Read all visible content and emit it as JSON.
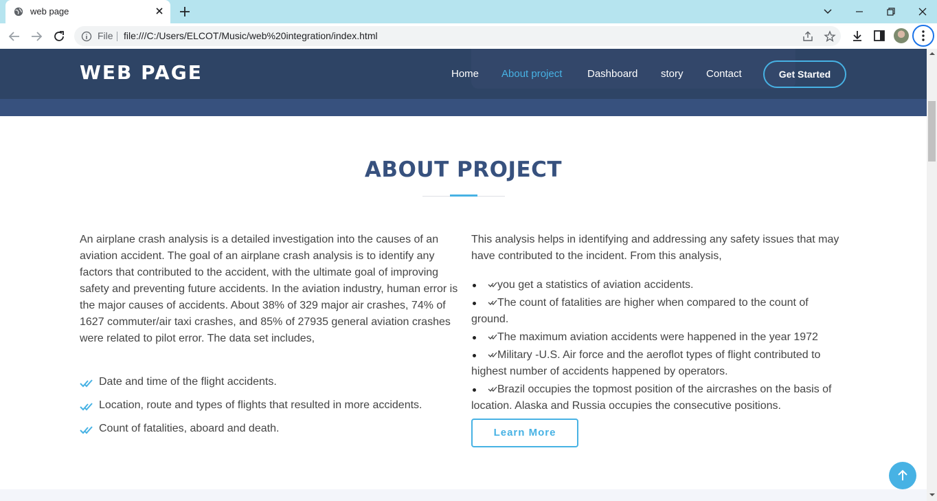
{
  "browser": {
    "tab_title": "web page",
    "omnibox": {
      "scheme_label": "File",
      "url": "file:///C:/Users/ELCOT/Music/web%20integration/index.html"
    },
    "icons": [
      "globe-icon",
      "close-icon",
      "plus-icon",
      "chevron-down-icon",
      "minimize-icon",
      "restore-icon",
      "window-close-icon",
      "back-arrow-icon",
      "forward-arrow-icon",
      "reload-icon",
      "info-icon",
      "share-icon",
      "star-icon",
      "download-icon",
      "sidebar-icon",
      "profile-avatar",
      "more-vert-icon"
    ]
  },
  "site": {
    "logo": "WEB PAGE",
    "nav": [
      {
        "label": "Home",
        "active": false
      },
      {
        "label": "About project",
        "active": true
      },
      {
        "label": "Dashboard",
        "active": false
      },
      {
        "label": "story",
        "active": false
      },
      {
        "label": "Contact",
        "active": false
      }
    ],
    "cta": "Get Started",
    "colors": {
      "header": "#2e4465",
      "accent": "#47b2e4",
      "title": "#37517e"
    }
  },
  "about": {
    "title": "ABOUT PROJECT",
    "left_paragraph": "An airplane crash analysis is a detailed investigation into the causes of an aviation accident. The goal of an airplane crash analysis is to identify any factors that contributed to the accident, with the ultimate goal of improving safety and preventing future accidents. In the aviation industry, human error is the major causes of accidents. About 38% of 329 major air crashes, 74% of 1627 commuter/air taxi crashes, and 85% of 27935 general aviation crashes were related to pilot error. The data set includes,",
    "left_list": [
      "Date and time of the flight accidents.",
      "Location, route and types of flights that resulted in more accidents.",
      "Count of fatalities, aboard and death."
    ],
    "right_paragraph": "This analysis helps in identifying and addressing any safety issues that may have contributed to the incident. From this analysis,",
    "right_list": [
      "you get a statistics of aviation accidents.",
      "The count of fatalities are higher when compared to the count of ground.",
      "The maximum aviation accidents were happened in the year 1972",
      "Military -U.S. Air force and the aeroflot types of flight contributed to highest number of accidents happened by operators.",
      "Brazil occupies the topmost position of the aircrashes on the basis of location. Alaska and Russia occupies the consecutive positions."
    ],
    "learn_more": "Learn More"
  }
}
